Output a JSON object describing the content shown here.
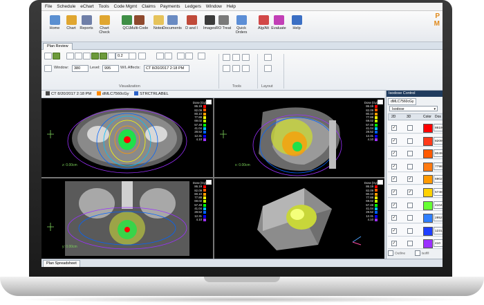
{
  "menu": [
    "File",
    "Schedule",
    "eChart",
    "Tools",
    "Code Mgmt",
    "Claims",
    "Payments",
    "Ledgers",
    "Window",
    "Help"
  ],
  "toolbar": [
    {
      "label": "Home",
      "icon": "home-icon",
      "color": "#5a8fd1"
    },
    {
      "label": "Chart",
      "icon": "chart-folder-icon",
      "color": "#e0a630"
    },
    {
      "label": "Reports",
      "icon": "reports-icon",
      "color": "#6f7fa8"
    },
    {
      "label": "Chart Check",
      "icon": "chart-check-icon",
      "color": "#e0a630"
    },
    {
      "label": "QCL",
      "icon": "qcl-icon",
      "color": "#3f8f46"
    },
    {
      "label": "Multi-Code",
      "icon": "multi-code-icon",
      "color": "#8f4a2e"
    },
    {
      "label": "Notes",
      "icon": "notes-icon",
      "color": "#e6c35a"
    },
    {
      "label": "Documents",
      "icon": "documents-icon",
      "color": "#6a8bc2"
    },
    {
      "label": "D and I",
      "icon": "d-and-i-icon",
      "color": "#c04a3a"
    },
    {
      "label": "Images",
      "icon": "images-icon",
      "color": "#3b3b3b"
    },
    {
      "label": "RO Treat",
      "icon": "ro-treat-icon",
      "color": "#7a7a7a"
    },
    {
      "label": "Quick Orders",
      "icon": "quick-orders-icon",
      "color": "#5c8ed6"
    },
    {
      "label": "Alg/Alt",
      "icon": "alg-alt-icon",
      "color": "#d24848"
    },
    {
      "label": "Evaluate",
      "icon": "evaluate-icon",
      "color": "#c23fb6"
    },
    {
      "label": "Help",
      "icon": "help-icon",
      "color": "#3b6fc4"
    }
  ],
  "brand": {
    "line1": "P",
    "line2": "M"
  },
  "tab": "Plan Review",
  "ribbon": {
    "zoom_value": "0.2",
    "window_label": "Window:",
    "window_value": "380",
    "level_label": "Level:",
    "level_value": "995",
    "wl_label": "W/L Affects:",
    "wl_value": "CT 8/20/2017 2:18 PM",
    "group_visualization": "Visualization",
    "group_tools": "Tools",
    "group_layout": "Layout"
  },
  "info": {
    "ct": "CT 8/20/2017 2:18 PM",
    "plan": "dMLC7560cGy",
    "struct": "STRCTRLABEL"
  },
  "dose_legend": {
    "header": "Dose [Gy]",
    "values": [
      "86.19",
      "82.09",
      "80.10",
      "77.88",
      "69.02",
      "57.48",
      "41.04",
      "28.52",
      "12.31",
      "4.10"
    ],
    "colors": [
      "#ff0000",
      "#ff5a00",
      "#ff9a00",
      "#ffff00",
      "#c0ff00",
      "#00ff00",
      "#00c0ff",
      "#0064ff",
      "#0000ff",
      "#9b30ff"
    ]
  },
  "views": {
    "axial_z": "z: 0.00cm",
    "sagittal_x": "x: 0.00cm",
    "coronal_y": "y: 0.00cm"
  },
  "status_tab": "Plan Spreadsheet",
  "isodose": {
    "title": "Isodose Control",
    "subtab": "dMLC7560cGy",
    "select": "Isodose",
    "headers": {
      "c2d": "2D",
      "c3d": "3D",
      "color": "Color",
      "dose": "Dos"
    },
    "rows": [
      {
        "c2d": true,
        "c3d": false,
        "color": "#ff0000",
        "dose": "8619"
      },
      {
        "c2d": true,
        "c3d": false,
        "color": "#ff3a1a",
        "dose": "8209"
      },
      {
        "c2d": true,
        "c3d": false,
        "color": "#ff5a00",
        "dose": "8049"
      },
      {
        "c2d": true,
        "c3d": false,
        "color": "#ff7a10",
        "dose": "7798"
      },
      {
        "c2d": true,
        "c3d": true,
        "color": "#ff9a00",
        "dose": "6902"
      },
      {
        "c2d": true,
        "c3d": true,
        "color": "#ffd200",
        "dose": "5748"
      },
      {
        "c2d": true,
        "c3d": false,
        "color": "#66ff33",
        "dose": "4104"
      },
      {
        "c2d": true,
        "c3d": false,
        "color": "#2f7fff",
        "dose": "2852"
      },
      {
        "c2d": true,
        "c3d": false,
        "color": "#1f3fff",
        "dose": "1231"
      },
      {
        "c2d": true,
        "c3d": false,
        "color": "#9b30ff",
        "dose": "410"
      }
    ],
    "foot_left": "Outline",
    "foot_right": "Isofill"
  }
}
